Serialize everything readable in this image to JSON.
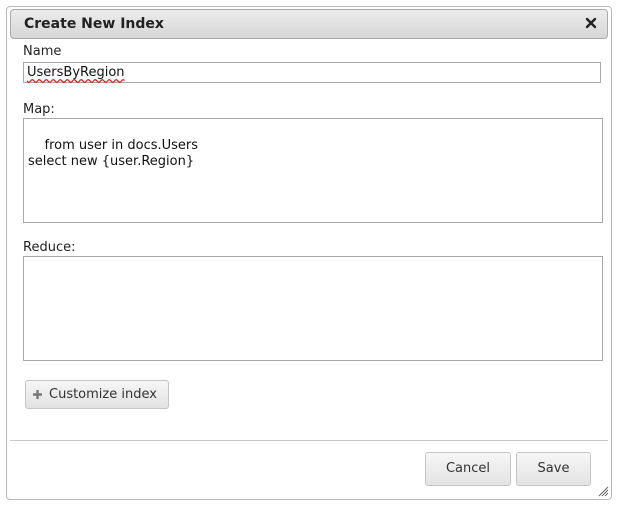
{
  "dialog": {
    "title": "Create New Index",
    "close_icon": "close-icon"
  },
  "form": {
    "name_label": "Name",
    "name_value": "UsersByRegion",
    "map_label": "Map:",
    "map_value": "from user in docs.Users\nselect new {user.Region}",
    "reduce_label": "Reduce:",
    "reduce_value": "",
    "customize_label": "Customize index",
    "customize_icon": "plus-icon"
  },
  "footer": {
    "cancel_label": "Cancel",
    "save_label": "Save"
  }
}
